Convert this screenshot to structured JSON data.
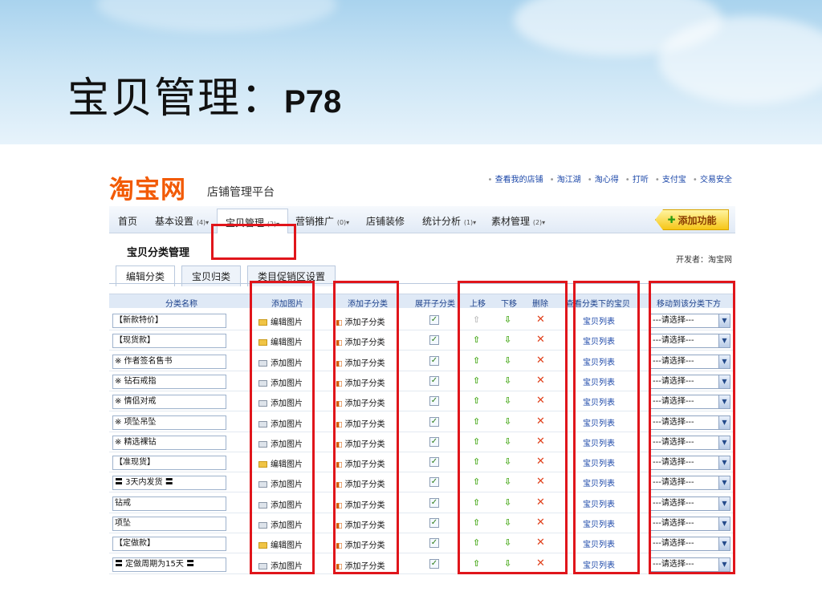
{
  "slide": {
    "title_cn": "宝贝管理：",
    "title_page": "P78"
  },
  "brand": {
    "logo": "淘宝网",
    "subtitle": "店铺管理平台"
  },
  "top_links": [
    "查看我的店铺",
    "淘江湖",
    "淘心得",
    "打听",
    "支付宝",
    "交易安全"
  ],
  "nav": {
    "items": [
      {
        "label": "首页",
        "badge": ""
      },
      {
        "label": "基本设置",
        "badge": "(4)▾"
      },
      {
        "label": "宝贝管理",
        "badge": "(2)▾"
      },
      {
        "label": "营销推广",
        "badge": "(0)▾"
      },
      {
        "label": "店铺装修",
        "badge": ""
      },
      {
        "label": "统计分析",
        "badge": "(1)▾"
      },
      {
        "label": "素材管理",
        "badge": "(2)▾"
      }
    ],
    "add_function": "添加功能"
  },
  "section_title": "宝贝分类管理",
  "developer": "开发者：淘宝网",
  "tabs": [
    "编辑分类",
    "宝贝归类",
    "类目促销区设置"
  ],
  "columns": [
    "分类名称",
    "添加图片",
    "添加子分类",
    "展开子分类",
    "上移",
    "下移",
    "删除",
    "查看分类下的宝贝",
    "移动到该分类下方"
  ],
  "rows": [
    {
      "name": "【新款特价】",
      "image_action": "编辑图片",
      "has_image": true
    },
    {
      "name": "【现货款】",
      "image_action": "编辑图片",
      "has_image": true
    },
    {
      "name": "※ 作者签名售书",
      "image_action": "添加图片",
      "has_image": false
    },
    {
      "name": "※ 钻石戒指",
      "image_action": "添加图片",
      "has_image": false
    },
    {
      "name": "※ 情侣对戒",
      "image_action": "添加图片",
      "has_image": false
    },
    {
      "name": "※ 项坠吊坠",
      "image_action": "添加图片",
      "has_image": false
    },
    {
      "name": "※ 精选裸钻",
      "image_action": "添加图片",
      "has_image": false
    },
    {
      "name": "【准现货】",
      "image_action": "编辑图片",
      "has_image": true
    },
    {
      "name": "〓 3天内发货 〓",
      "image_action": "添加图片",
      "has_image": false
    },
    {
      "name": "钻戒",
      "image_action": "添加图片",
      "has_image": false
    },
    {
      "name": "项坠",
      "image_action": "添加图片",
      "has_image": false
    },
    {
      "name": "【定做款】",
      "image_action": "编辑图片",
      "has_image": true
    },
    {
      "name": "〓 定做周期为15天 〓",
      "image_action": "添加图片",
      "has_image": false
    }
  ],
  "row_labels": {
    "add_sub": "添加子分类",
    "list": "宝贝列表",
    "select": "---请选择---"
  },
  "colors": {
    "highlight": "#e0151b",
    "brand": "#f25a05",
    "link": "#1a46a8"
  }
}
